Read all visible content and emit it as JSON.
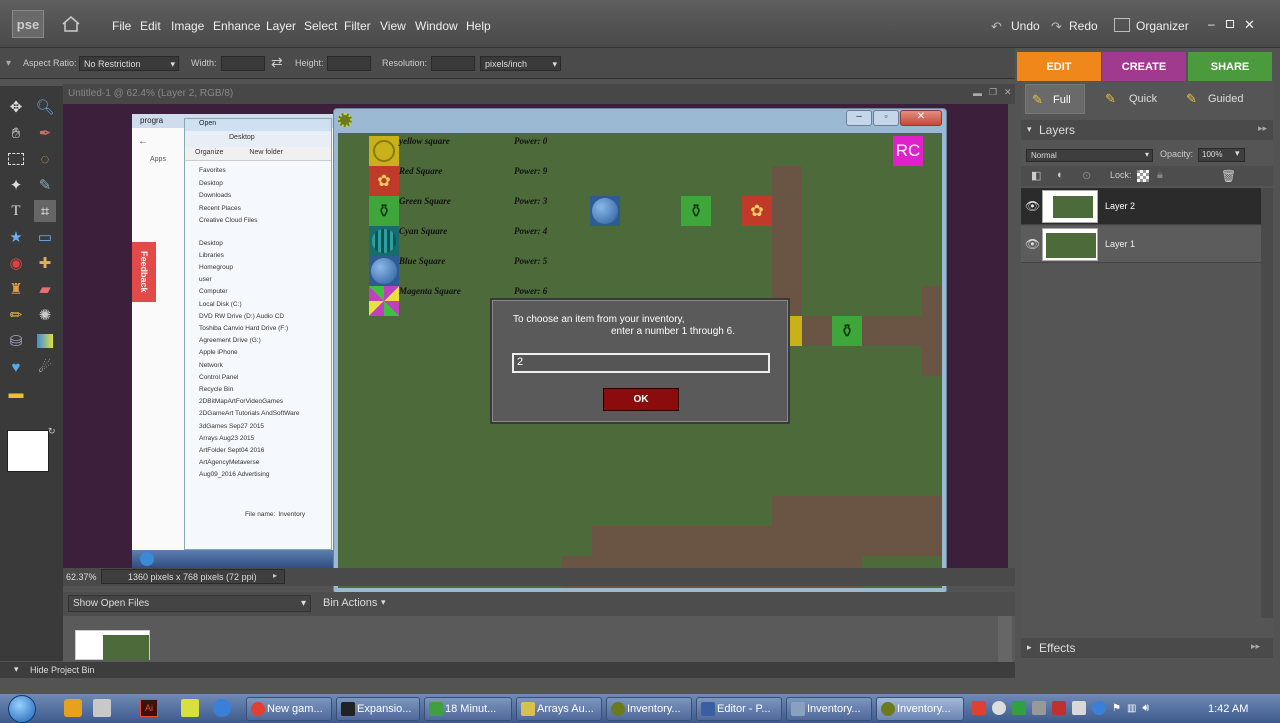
{
  "menubar": {
    "logo": "pse",
    "menus": [
      "File",
      "Edit",
      "Image",
      "Enhance",
      "Layer",
      "Select",
      "Filter",
      "View",
      "Window",
      "Help"
    ],
    "undo": "Undo",
    "redo": "Redo",
    "organizer": "Organizer"
  },
  "options": {
    "aspect_label": "Aspect Ratio:",
    "aspect_value": "No Restriction",
    "width_label": "Width:",
    "height_label": "Height:",
    "resolution_label": "Resolution:",
    "resolution_unit": "pixels/inch"
  },
  "modes": {
    "edit": "EDIT",
    "create": "CREATE",
    "share": "SHARE"
  },
  "edit_modes": {
    "full": "Full",
    "quick": "Quick",
    "guided": "Guided"
  },
  "document": {
    "title": "Untitled-1 @ 62.4% (Layer 2, RGB/8)",
    "zoom": "62.37%",
    "size_info": "1360 pixels x 768 pixels (72 ppi)"
  },
  "layers": {
    "panel_title": "Layers",
    "blend_mode": "Normal",
    "opacity_label": "Opacity:",
    "opacity_value": "100%",
    "lock_label": "Lock:",
    "items": [
      {
        "name": "Layer 2"
      },
      {
        "name": "Layer 1"
      }
    ]
  },
  "effects": {
    "title": "Effects"
  },
  "project_bin": {
    "show": "Show Open Files",
    "actions": "Bin Actions",
    "hide": "Hide Project Bin"
  },
  "embedded": {
    "tab": "progra",
    "dialog_title": "Open",
    "location": "Desktop",
    "organize": "Organize",
    "new_folder": "New folder",
    "apps": "Apps",
    "feedback": "Feedback",
    "favorites": [
      "Favorites",
      "Desktop",
      "Downloads",
      "Recent Places",
      "Creative Cloud Files"
    ],
    "tree": [
      "Desktop",
      "Libraries",
      "Homegroup",
      "user",
      "Computer",
      "Local Disk (C:)",
      "DVD RW Drive (D:) Audio CD",
      "Toshiba Canvio Hard Drive (F:)",
      "Agreement Drive (G:)",
      "Apple iPhone",
      "Network",
      "Control Panel",
      "Recycle Bin",
      "2DBitMapArtForVideoGames",
      "2DGameArt Tutorials AndSoftWare",
      "3dGames Sep27 2015",
      "Arrays Aug23 2015",
      "ArtFolder Sept04 2016",
      "ArtAgencyMetaverse",
      "Aug09_2016 Advertising"
    ],
    "filename_label": "File name:",
    "filename_value": "Inventory"
  },
  "game": {
    "items": [
      {
        "name": "yellow square",
        "power": "Power: 0"
      },
      {
        "name": "Red Square",
        "power": "Power: 9"
      },
      {
        "name": "Green Square",
        "power": "Power: 3"
      },
      {
        "name": "Cyan Square",
        "power": "Power: 4"
      },
      {
        "name": "Blue Square",
        "power": "Power: 5"
      },
      {
        "name": "Magenta Square",
        "power": "Power: 6"
      }
    ],
    "badge": "RC"
  },
  "dialog": {
    "line1": "To choose an item from your inventory,",
    "line2": "enter a number 1 through 6.",
    "input_value": "2",
    "ok": "OK"
  },
  "taskbar": {
    "buttons": [
      "New gam...",
      "Expansio...",
      "18 Minut...",
      "Arrays Au...",
      "Inventory...",
      "Editor - P...",
      "Inventory...",
      "Inventory..."
    ],
    "clock": "1:42 AM"
  },
  "colors": {
    "edit_tab": "#f0871b",
    "create_tab": "#a03a8e",
    "share_tab": "#4b9b3e",
    "ok_button": "#8b0c0c"
  }
}
